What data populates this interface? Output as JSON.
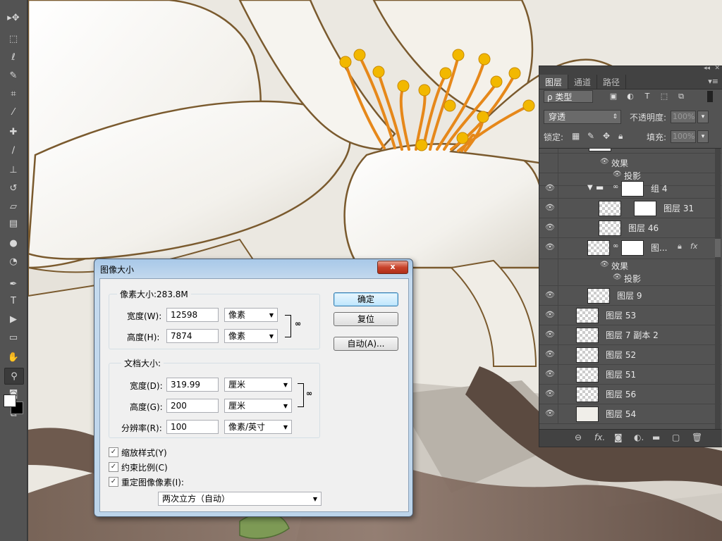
{
  "toolbox": {
    "tools": [
      {
        "name": "move-tool",
        "glyph": "▸✥"
      },
      {
        "name": "marquee-tool",
        "glyph": "⬚"
      },
      {
        "name": "lasso-tool",
        "glyph": "ℓ"
      },
      {
        "name": "quick-select-tool",
        "glyph": "✎"
      },
      {
        "name": "crop-tool",
        "glyph": "⌗"
      },
      {
        "name": "eyedropper-tool",
        "glyph": "⁄"
      },
      {
        "name": "healing-tool",
        "glyph": "✚"
      },
      {
        "name": "brush-tool",
        "glyph": "∕"
      },
      {
        "name": "stamp-tool",
        "glyph": "⊥"
      },
      {
        "name": "history-brush-tool",
        "glyph": "↺"
      },
      {
        "name": "eraser-tool",
        "glyph": "▱"
      },
      {
        "name": "gradient-tool",
        "glyph": "▤"
      },
      {
        "name": "blur-tool",
        "glyph": "●"
      },
      {
        "name": "dodge-tool",
        "glyph": "◔"
      },
      {
        "name": "pen-tool",
        "glyph": "✒"
      },
      {
        "name": "type-tool",
        "glyph": "T"
      },
      {
        "name": "path-select-tool",
        "glyph": "▶"
      },
      {
        "name": "rectangle-tool",
        "glyph": "▭"
      },
      {
        "name": "hand-tool",
        "glyph": "✋"
      },
      {
        "name": "zoom-tool",
        "glyph": "⚲"
      },
      {
        "name": "quick-mask-tool",
        "glyph": "◙"
      },
      {
        "name": "screen-mode-tool",
        "glyph": "⧉"
      }
    ]
  },
  "layers_panel": {
    "tabs": [
      "图层",
      "通道",
      "路径"
    ],
    "active_tab": "图层",
    "kind_filter": "ρ 类型",
    "blend_mode": "穿透",
    "opacity_label": "不透明度:",
    "opacity_value": "100%",
    "lock_label": "锁定:",
    "fill_label": "填充:",
    "fill_value": "100%",
    "layers": [
      {
        "name": "效果",
        "type": "effect-header",
        "indent": 1
      },
      {
        "name": "投影",
        "type": "effect",
        "indent": 1
      },
      {
        "name": "组 4",
        "type": "group"
      },
      {
        "name": "图层 31",
        "type": "masked"
      },
      {
        "name": "图层 46",
        "type": "plain-indent"
      },
      {
        "name": "图...",
        "type": "masked-fx"
      },
      {
        "name": "效果",
        "type": "effect-header",
        "indent": 2
      },
      {
        "name": "投影",
        "type": "effect",
        "indent": 2
      },
      {
        "name": "图层 9",
        "type": "plain-indent"
      },
      {
        "name": "图层 53",
        "type": "plain"
      },
      {
        "name": "图层 7 副本 2",
        "type": "plain"
      },
      {
        "name": "图层 52",
        "type": "plain"
      },
      {
        "name": "图层 51",
        "type": "plain"
      },
      {
        "name": "图层 56",
        "type": "plain"
      },
      {
        "name": "图层 54",
        "type": "plain"
      }
    ],
    "fx_label": "fx"
  },
  "dialog": {
    "title": "图像大小",
    "close_label": "x",
    "pixel_group_label": "像素大小:283.8M",
    "width_label": "宽度(W):",
    "width_value": "12598",
    "width_unit": "像素",
    "height_label": "高度(H):",
    "height_value": "7874",
    "height_unit": "像素",
    "doc_group_label": "文档大小:",
    "doc_width_label": "宽度(D):",
    "doc_width_value": "319.99",
    "doc_width_unit": "厘米",
    "doc_height_label": "高度(G):",
    "doc_height_value": "200",
    "doc_height_unit": "厘米",
    "resolution_label": "分辨率(R):",
    "resolution_value": "100",
    "resolution_unit": "像素/英寸",
    "scale_styles_label": "缩放样式(Y)",
    "constrain_label": "约束比例(C)",
    "resample_label": "重定图像像素(I):",
    "resample_method": "两次立方（自动）",
    "ok_label": "确定",
    "reset_label": "复位",
    "auto_label": "自动(A)..."
  }
}
